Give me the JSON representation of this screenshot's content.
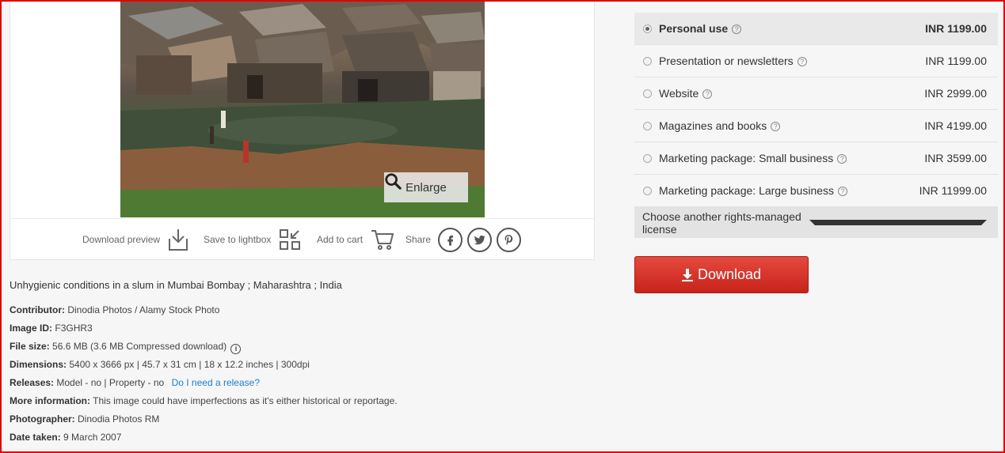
{
  "image": {
    "alt": "Slum houses beside stagnant water",
    "enlarge_label": "Enlarge"
  },
  "actions": {
    "download_preview": "Download preview",
    "save_to_lightbox": "Save to lightbox",
    "add_to_cart": "Add to cart",
    "share": "Share"
  },
  "caption": "Unhygienic conditions in a slum in Mumbai Bombay ; Maharashtra ; India",
  "meta": {
    "contributor_label": "Contributor:",
    "contributor": "Dinodia Photos / Alamy Stock Photo",
    "image_id_label": "Image ID:",
    "image_id": "F3GHR3",
    "file_size_label": "File size:",
    "file_size": "56.6 MB (3.6 MB Compressed download)",
    "dimensions_label": "Dimensions:",
    "dimensions": "5400 x 3666 px | 45.7 x 31 cm | 18 x 12.2 inches | 300dpi",
    "releases_label": "Releases:",
    "releases": "Model - no | Property - no",
    "release_link": "Do I need a release?",
    "more_info_label": "More information:",
    "more_info": "This image could have imperfections as it's either historical or reportage.",
    "photographer_label": "Photographer:",
    "photographer": "Dinodia Photos RM",
    "date_taken_label": "Date taken:",
    "date_taken": "9 March 2007"
  },
  "licenses": [
    {
      "name": "Personal use",
      "price": "INR 1199.00",
      "selected": true
    },
    {
      "name": "Presentation or newsletters",
      "price": "INR 1199.00",
      "selected": false
    },
    {
      "name": "Website",
      "price": "INR 2999.00",
      "selected": false
    },
    {
      "name": "Magazines and books",
      "price": "INR 4199.00",
      "selected": false
    },
    {
      "name": "Marketing package: Small business",
      "price": "INR 3599.00",
      "selected": false
    },
    {
      "name": "Marketing package: Large business",
      "price": "INR 11999.00",
      "selected": false
    }
  ],
  "choose_other": "Choose another rights-managed license",
  "download_label": "Download",
  "colors": {
    "accent_red": "#d0261d",
    "link_blue": "#1a7fd4",
    "frame_red": "#e00000"
  }
}
